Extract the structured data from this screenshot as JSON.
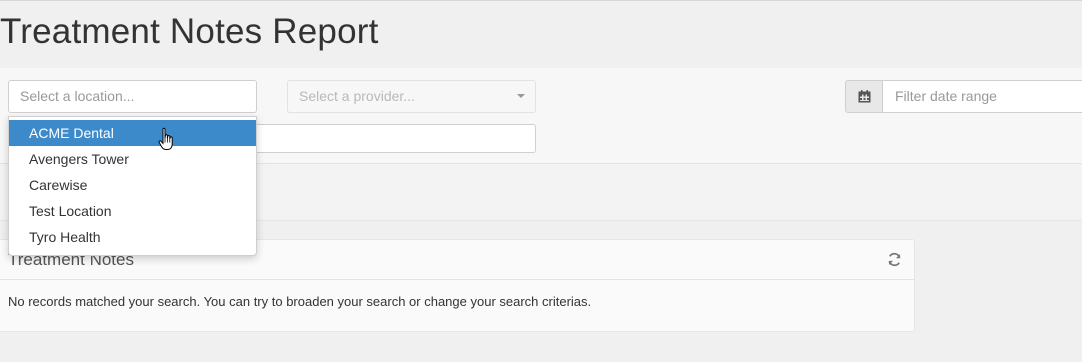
{
  "page": {
    "title": "Treatment Notes Report"
  },
  "filters": {
    "location_placeholder": "Select a location...",
    "provider_placeholder": "Select a provider...",
    "date_placeholder": "Filter date range"
  },
  "location_dropdown": {
    "options": [
      "ACME Dental",
      "Avengers Tower",
      "Carewise",
      "Test Location",
      "Tyro Health"
    ],
    "active_index": 0
  },
  "panel": {
    "title": "Treatment Notes",
    "empty_message": "No records matched your search. You can try to broaden your search or change your search criterias."
  },
  "icons": {
    "calendar": "calendar-icon",
    "refresh": "refresh-icon",
    "cursor": "hand-pointer-icon"
  },
  "colors": {
    "active_option": "#3d8acb",
    "background": "#f0f0f0"
  }
}
